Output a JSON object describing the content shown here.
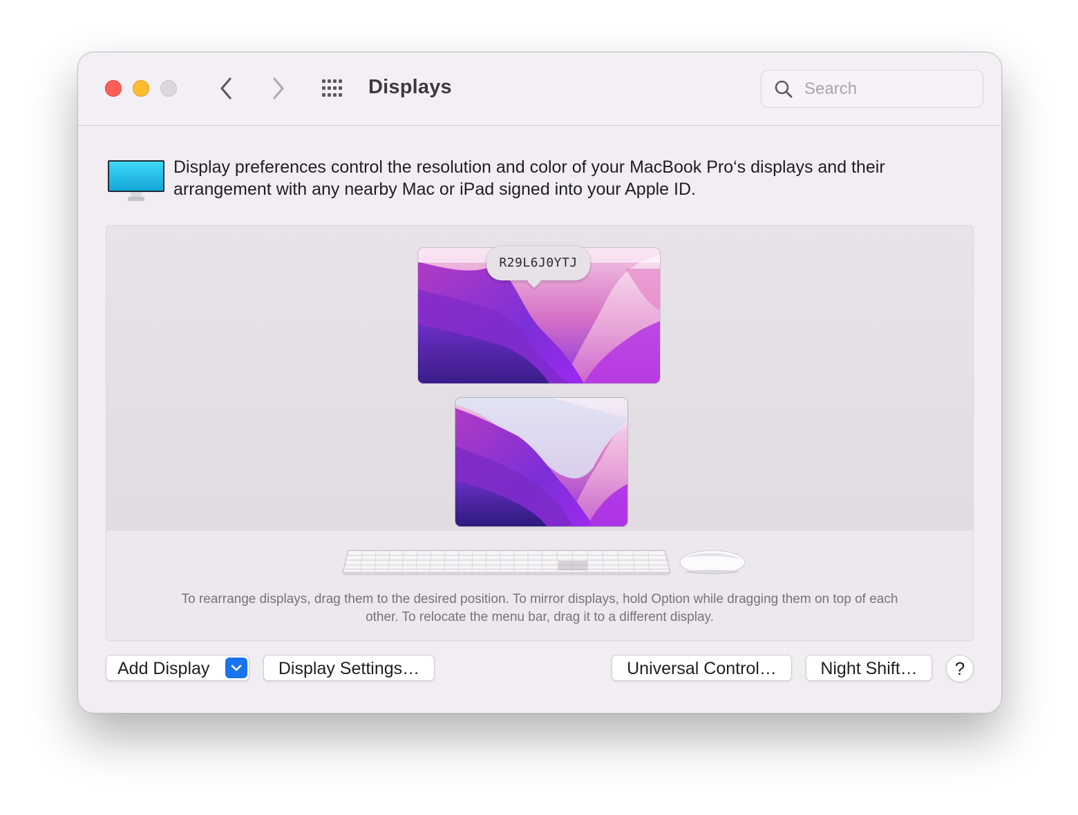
{
  "window": {
    "title": "Displays",
    "controls": [
      "close",
      "minimize",
      "zoom"
    ],
    "nav": {
      "back_icon": "chevron-left-icon",
      "forward_icon": "chevron-right-icon",
      "grid_icon": "grid-icon"
    }
  },
  "search": {
    "placeholder": "Search",
    "value": ""
  },
  "header": {
    "icon": "display-monitor-icon",
    "description": "Display preferences control the resolution and color of your MacBook Pro‘s displays and their arrangement with any nearby Mac or iPad signed into your Apple ID."
  },
  "arrangement": {
    "tooltip": "R29L6J0YTJ",
    "displays": [
      {
        "name": "external-display",
        "has_menu_bar": true
      },
      {
        "name": "builtin-display",
        "has_menu_bar": false
      }
    ],
    "hint": "To rearrange displays, drag them to the desired position. To mirror displays, hold Option while dragging them on top of each other. To relocate the menu bar, drag it to a different display."
  },
  "buttons": {
    "add_display": "Add Display",
    "display_settings": "Display Settings…",
    "universal_control": "Universal Control…",
    "night_shift": "Night Shift…",
    "help": "?"
  },
  "colors": {
    "close": "#fe5f57",
    "minimize": "#febc2e",
    "zoom": "#dcd7dd",
    "accent": "#1a74ee",
    "window_bg": "#f2edf3"
  }
}
